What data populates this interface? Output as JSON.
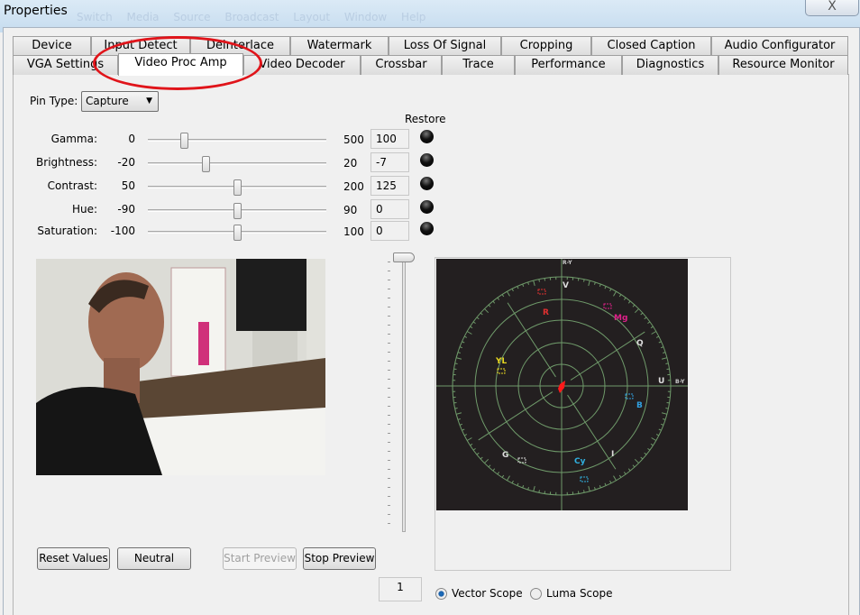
{
  "window": {
    "title": "Properties",
    "background_menu": "Switch Media Source Broadcast Layout Window Help",
    "close_label": "X"
  },
  "tabs_top": [
    "Device",
    "Input Detect",
    "Deinterlace",
    "Watermark",
    "Loss Of Signal",
    "Cropping",
    "Closed Caption",
    "Audio Configurator"
  ],
  "tabs_bottom": [
    "VGA Settings",
    "Video Proc Amp",
    "Video Decoder",
    "Crossbar",
    "Trace",
    "Performance",
    "Diagnostics",
    "Resource Monitor"
  ],
  "selected_tab": "Video Proc Amp",
  "annotation_color": "#e0141a",
  "pin_type": {
    "label": "Pin Type:",
    "value": "Capture"
  },
  "restore_label": "Restore",
  "controls": [
    {
      "label": "Gamma:",
      "min": "0",
      "max": "500",
      "value": "100"
    },
    {
      "label": "Brightness:",
      "min": "-20",
      "max": "20",
      "value": "-7"
    },
    {
      "label": "Contrast:",
      "min": "50",
      "max": "200",
      "value": "125"
    },
    {
      "label": "Hue:",
      "min": "-90",
      "max": "90",
      "value": "0"
    },
    {
      "label": "Saturation:",
      "min": "-100",
      "max": "100",
      "value": "0"
    }
  ],
  "scope_zoom_slider": {
    "value_percent": 100
  },
  "scope": {
    "labels": {
      "ry": "R-Y",
      "by": "B-Y",
      "v": "V",
      "u": "U",
      "q": "Q",
      "i": "I",
      "r": "R",
      "mg": "Mg",
      "yl": "YL",
      "g": "G",
      "cy": "Cy",
      "b": "B"
    },
    "grid_color": "#6f9a6a",
    "background": "#231f20"
  },
  "buttons": {
    "reset": "Reset Values",
    "neutral": "Neutral",
    "start": "Start Preview",
    "stop": "Stop Preview"
  },
  "scope_gain": "1",
  "scope_mode": {
    "vector": "Vector Scope",
    "luma": "Luma Scope",
    "selected": "vector"
  }
}
